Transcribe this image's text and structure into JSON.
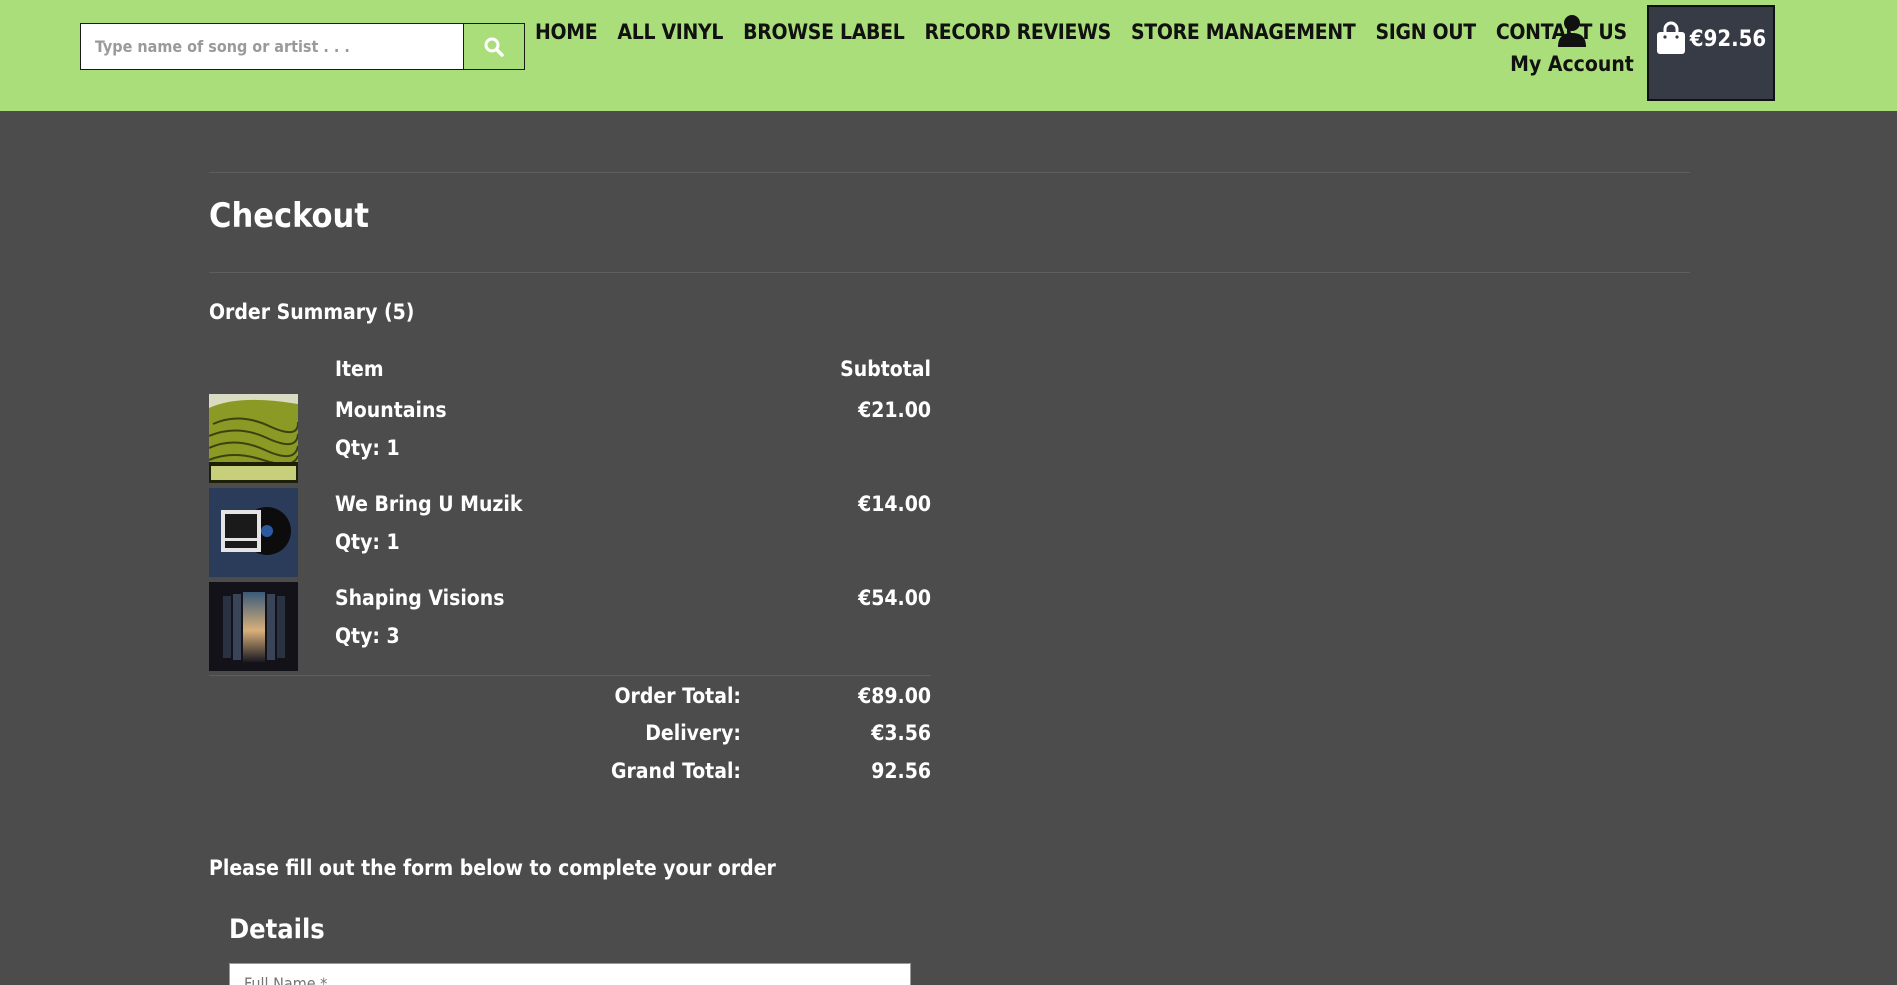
{
  "header": {
    "search": {
      "placeholder": "Type name of song or artist . . .",
      "value": ""
    },
    "nav": [
      "HOME",
      "ALL VINYL",
      "BROWSE LABEL",
      "RECORD REVIEWS",
      "STORE MANAGEMENT",
      "SIGN OUT",
      "CONTACT US"
    ],
    "account_label": "My Account",
    "cart_total": "€92.56"
  },
  "checkout": {
    "title": "Checkout",
    "summary_title": "Order Summary (5)",
    "col_item": "Item",
    "col_subtotal": "Subtotal",
    "items": [
      {
        "name": "Mountains",
        "qty": "Qty: 1",
        "price": "€21.00"
      },
      {
        "name": "We Bring U Muzik",
        "qty": "Qty: 1",
        "price": "€14.00"
      },
      {
        "name": "Shaping Visions",
        "qty": "Qty: 3",
        "price": "€54.00"
      }
    ],
    "totals": [
      {
        "label": "Order Total:",
        "value": "€89.00"
      },
      {
        "label": "Delivery:",
        "value": "€3.56"
      },
      {
        "label": "Grand Total:",
        "value": "92.56"
      }
    ],
    "form_intro": "Please fill out the form below to complete your order",
    "details_title": "Details",
    "full_name_placeholder": "Full Name *"
  },
  "colors": {
    "header_bg": "#aade7a",
    "page_bg": "#4c4c4c",
    "cart_bg": "#363b45"
  }
}
